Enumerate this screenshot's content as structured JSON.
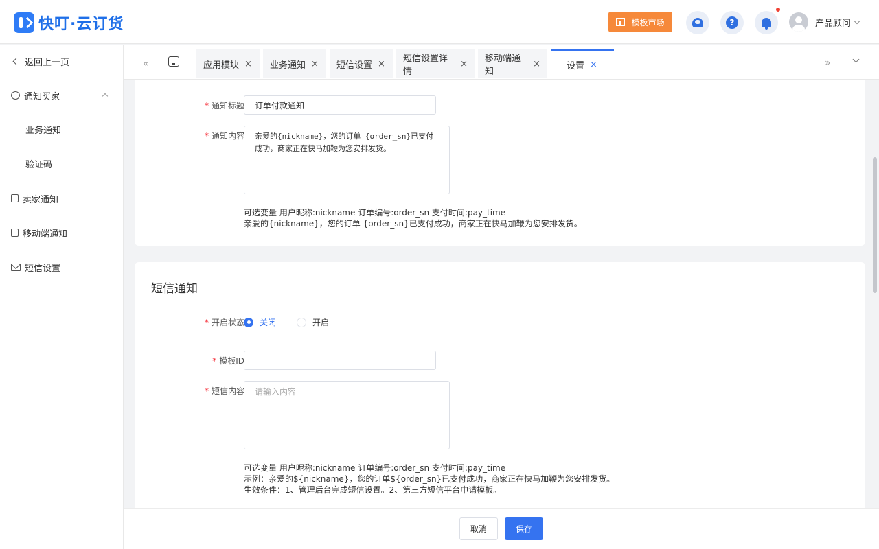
{
  "app": {
    "logo_text": "快叮·云订货"
  },
  "header": {
    "market_label": "模板市场",
    "help_glyph": "?",
    "user_name": "产品顾问"
  },
  "sidebar": {
    "back_label": "返回上一页",
    "items": [
      {
        "label": "通知买家",
        "icon": "chat-icon"
      },
      {
        "label": "业务通知"
      },
      {
        "label": "验证码"
      },
      {
        "label": "卖家通知",
        "icon": "doc-icon"
      },
      {
        "label": "移动端通知",
        "icon": "doc-icon"
      },
      {
        "label": "短信设置",
        "icon": "mail-icon"
      }
    ]
  },
  "tabs": {
    "nav_left": "«",
    "nav_right": "»",
    "close_glyph": "×",
    "items": [
      {
        "label": "应用模块"
      },
      {
        "label": "业务通知"
      },
      {
        "label": "短信设置"
      },
      {
        "label": "短信设置详情"
      },
      {
        "label": "移动端通知"
      },
      {
        "label": "设置",
        "active": true
      }
    ]
  },
  "notify_form": {
    "required_mark": "*",
    "title_label": "通知标题",
    "title_value": "订单付款通知",
    "content_label": "通知内容",
    "content_value": "亲爱的{nickname}，您的订单 {order_sn}已支付成功，商家正在快马加鞭为您安排发货。",
    "hint_line1": "可选变量 用户昵称:nickname 订单编号:order_sn 支付时间:pay_time",
    "hint_line2": "亲爱的{nickname}，您的订单 {order_sn}已支付成功，商家正在快马加鞭为您安排发货。"
  },
  "sms_form": {
    "section_title": "短信通知",
    "status_label": "开启状态",
    "status_options": [
      "关闭",
      "开启"
    ],
    "status_selected": "关闭",
    "template_label": "模板ID",
    "template_value": "",
    "content_label": "短信内容",
    "content_placeholder": "请输入内容",
    "hint_line1": "可选变量 用户昵称:nickname 订单编号:order_sn 支付时间:pay_time",
    "hint_line2": "示例：亲爱的${nickname}，您的订单${order_sn}已支付成功，商家正在快马加鞭为您安排发货。",
    "hint_line3": "生效条件：1、管理后台完成短信设置。2、第三方短信平台申请模板。"
  },
  "footer": {
    "cancel_label": "取消",
    "save_label": "保存"
  },
  "colors": {
    "primary": "#3573f0",
    "accent": "#f6893a",
    "required": "#f5222d"
  }
}
